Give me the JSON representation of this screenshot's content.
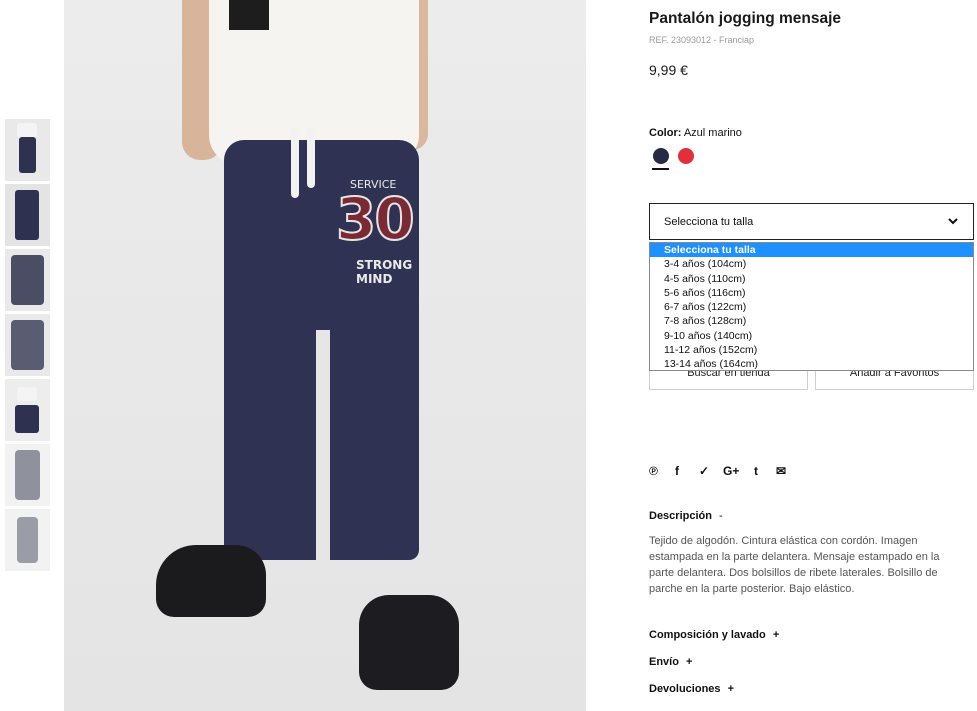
{
  "product": {
    "title": "Pantalón jogging mensaje",
    "ref": "REF. 23093012 - Franciap",
    "price": "9,99 €"
  },
  "color": {
    "label": "Color:",
    "value": "Azul marino",
    "swatches": [
      {
        "name": "Azul marino",
        "hex": "#262a42",
        "selected": true
      },
      {
        "name": "Rojo",
        "hex": "#e0303a",
        "selected": false
      }
    ]
  },
  "size_select": {
    "label": "Selecciona tu talla",
    "options": [
      "Selecciona tu talla",
      "3-4 años (104cm)",
      "4-5 años (110cm)",
      "5-6 años (116cm)",
      "6-7 años (122cm)",
      "7-8 años (128cm)",
      "9-10 años (140cm)",
      "11-12 años (152cm)",
      "13-14 años (164cm)"
    ],
    "highlighted_index": 0,
    "highlight_color": "#1e90ff"
  },
  "buttons": {
    "store": "Buscar en tienda",
    "favorites": "Añadir a Favoritos"
  },
  "share_icons": [
    "pinterest-icon",
    "facebook-icon",
    "twitter-icon",
    "google-plus-icon",
    "tumblr-icon",
    "email-icon"
  ],
  "share_glyphs": [
    "℗",
    "f",
    "✓",
    "G+",
    "t",
    "✉"
  ],
  "description": {
    "heading": "Descripción",
    "toggle": "-",
    "text": "Tejido de algodón. Cintura elástica con cordón. Imagen estampada en la parte delantera. Mensaje estampado en la parte delantera. Dos bolsillos de ribete laterales. Bolsillo de parche en la parte posterior. Bajo elástico."
  },
  "sections": [
    {
      "heading": "Composición y lavado",
      "toggle": "+"
    },
    {
      "heading": "Envío",
      "toggle": "+"
    },
    {
      "heading": "Devoluciones",
      "toggle": "+"
    }
  ],
  "photo_print": {
    "top": "SERVICE",
    "number": "30",
    "line1": "STRONG",
    "line2": "MIND"
  }
}
